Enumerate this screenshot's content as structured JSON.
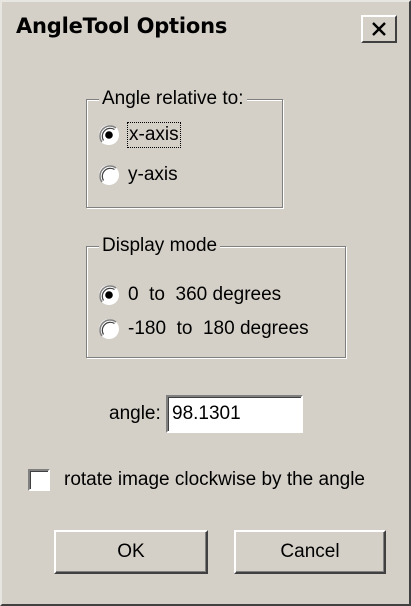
{
  "window": {
    "title": "AngleTool Options",
    "close_symbol": "close-icon"
  },
  "angle_relative": {
    "legend": "Angle relative to:",
    "options": [
      {
        "label": "x-axis",
        "checked": true
      },
      {
        "label": "y-axis",
        "checked": false
      }
    ]
  },
  "display_mode": {
    "legend": "Display mode",
    "options": [
      {
        "label": "0  to  360 degrees",
        "checked": true
      },
      {
        "label": "-180  to  180 degrees",
        "checked": false
      }
    ]
  },
  "angle": {
    "label": "angle:",
    "value": "98.1301"
  },
  "rotate": {
    "label": "rotate image clockwise by the angle",
    "checked": false
  },
  "buttons": {
    "ok": "OK",
    "cancel": "Cancel"
  }
}
